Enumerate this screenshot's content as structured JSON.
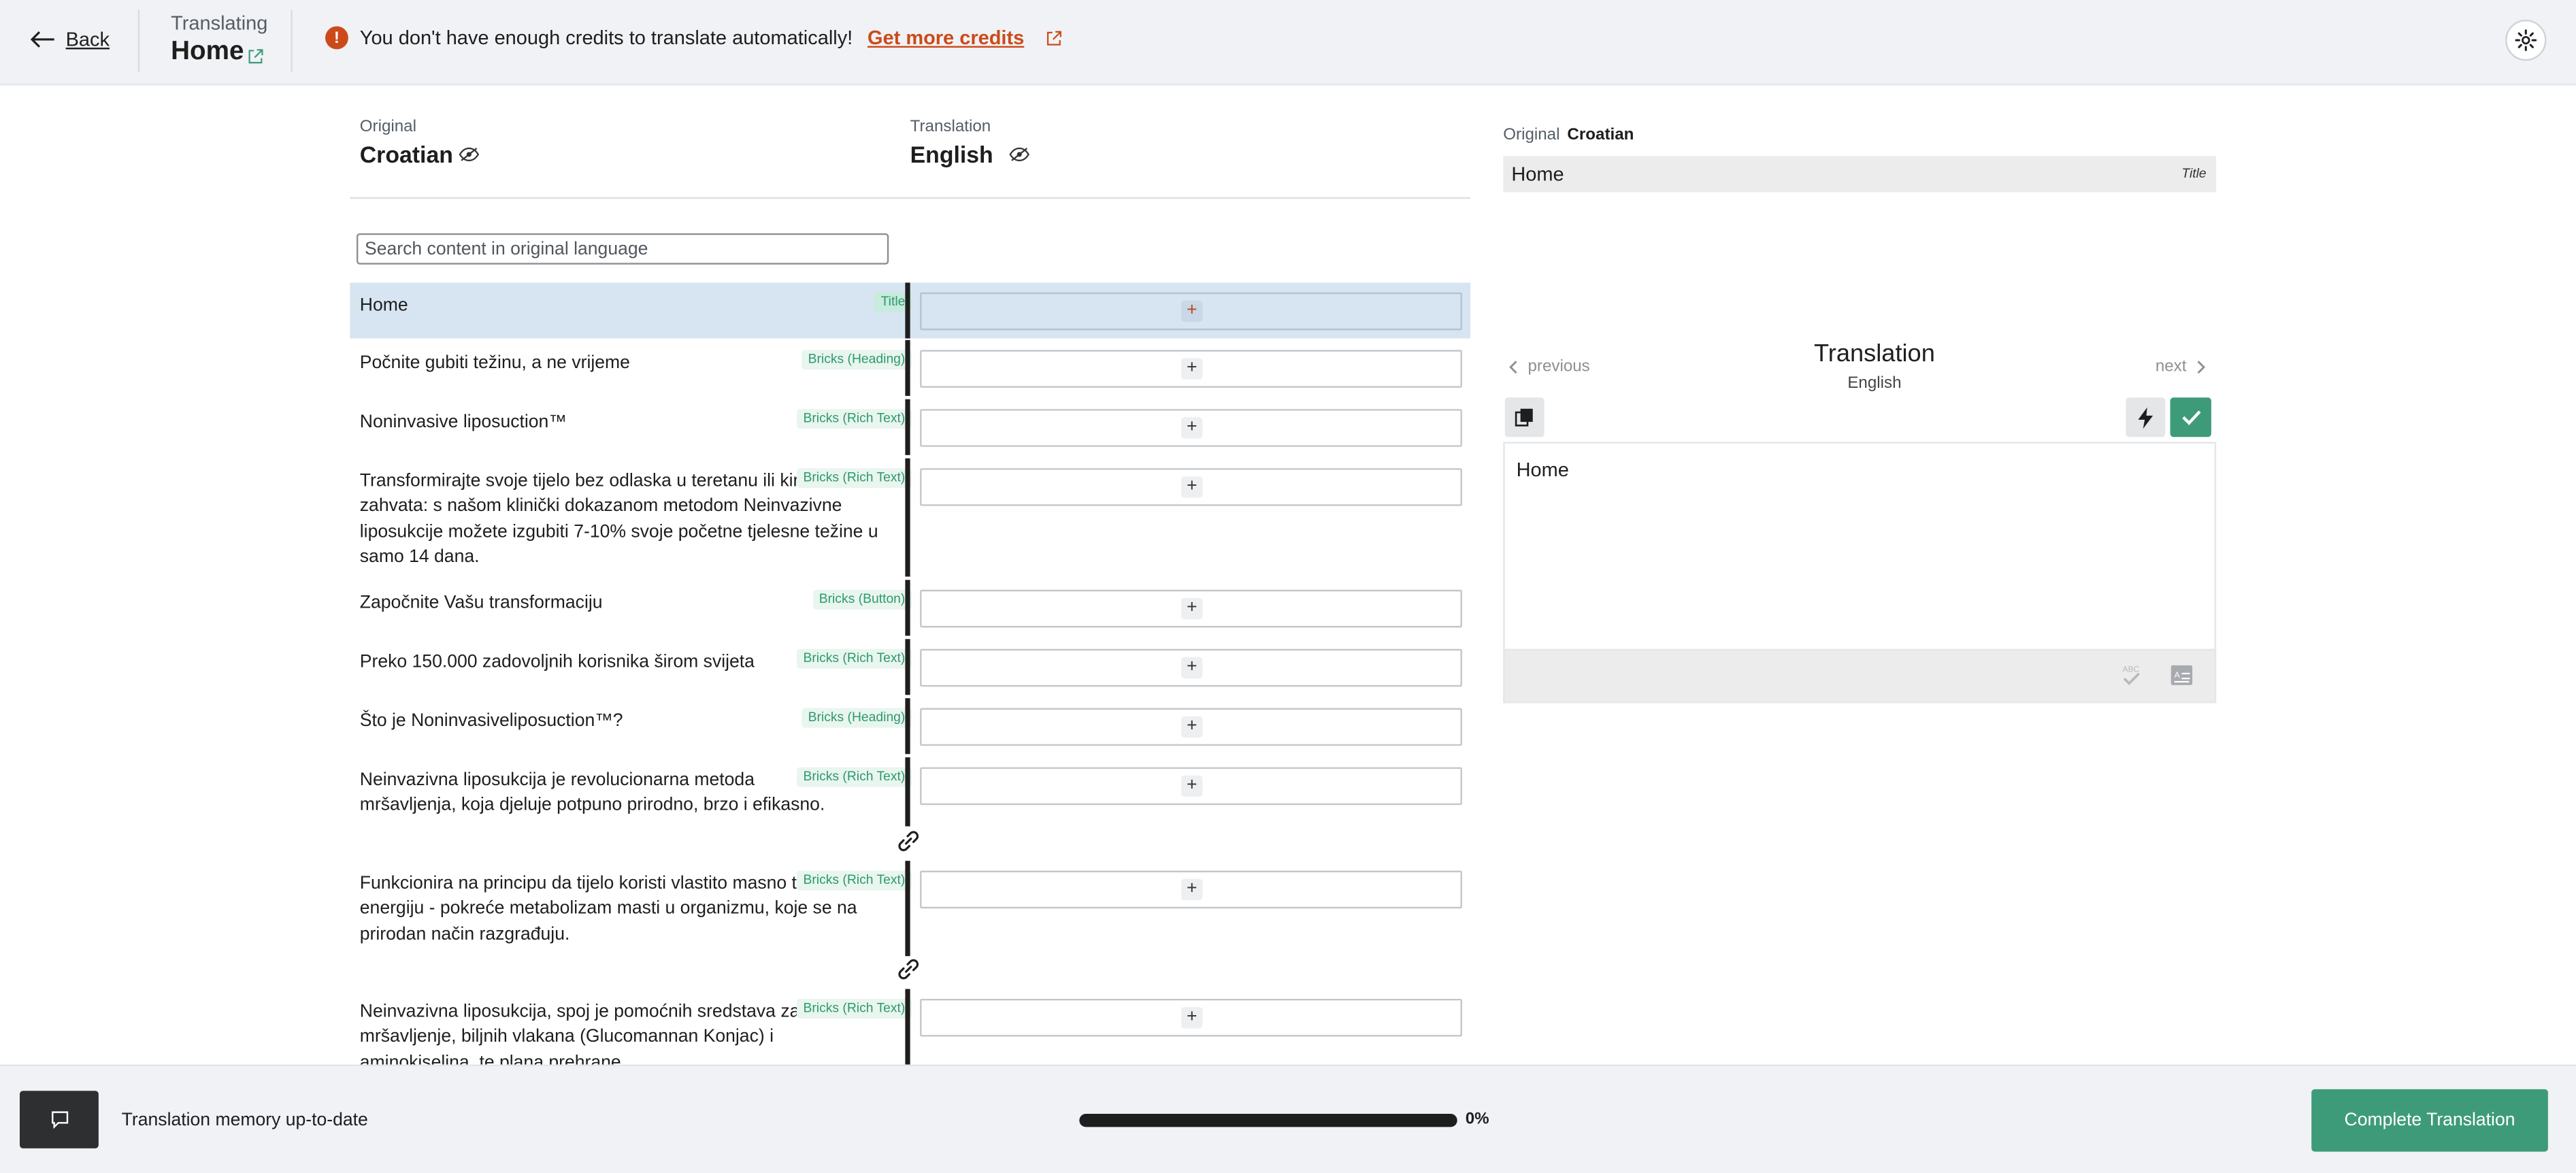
{
  "header": {
    "back_label": "Back",
    "translating_label": "Translating",
    "page_name": "Home",
    "notice_text": "You don't have enough credits to translate automatically!",
    "notice_link": "Get more credits",
    "notice_color": "#cc4a1a"
  },
  "languages": {
    "original_label": "Original",
    "original_name": "Croatian",
    "translation_label": "Translation",
    "translation_name": "English"
  },
  "search": {
    "placeholder": "Search content in original language"
  },
  "rows": [
    {
      "text": "Home",
      "tag": "Title",
      "active": true
    },
    {
      "text": "Počnite gubiti težinu, a ne vrijeme",
      "tag": "Bricks (Heading)"
    },
    {
      "text": "Noninvasive liposuction™",
      "tag": "Bricks (Rich Text)"
    },
    {
      "text": "Transformirajte svoje tijelo bez odlaska u teretanu ili kirurških zahvata: s našom klinički dokazanom metodom Neinvazivne liposukcije možete izgubiti 7-10% svoje početne tjelesne težine u samo 14 dana.",
      "tag": "Bricks (Rich Text)"
    },
    {
      "text": "Započnite Vašu transformaciju",
      "tag": "Bricks (Button)"
    },
    {
      "text": "Preko 150.000 zadovoljnih korisnika širom svijeta",
      "tag": "Bricks (Rich Text)"
    },
    {
      "text": "Što je Noninvasiveliposuction™?",
      "tag": "Bricks (Heading)"
    },
    {
      "text": "Neinvazivna liposukcija je revolucionarna metoda mršavljenja, koja djeluje potpuno prirodno, brzo i efikasno.",
      "tag": "Bricks (Rich Text)"
    },
    {
      "text": "Funkcionira na principu da tijelo koristi vlastito masno tkivo kao energiju - pokreće metabolizam masti u organizmu, koje se na prirodan način razgrađuju.",
      "tag": "Bricks (Rich Text)"
    },
    {
      "text": "Neinvazivna liposukcija, spoj je pomoćnih sredstava za mršavljenje, biljnih vlakana (Glucomannan Konjac) i aminokiselina, te plana prehrane.",
      "tag": "Bricks (Rich Text)"
    }
  ],
  "panel": {
    "original_label": "Original",
    "original_lang": "Croatian",
    "original_text": "Home",
    "original_type": "Title",
    "previous_label": "previous",
    "next_label": "next",
    "title": "Translation",
    "subtitle": "English",
    "editor_text": "Home"
  },
  "footer": {
    "memory_text": "Translation memory up-to-date",
    "progress_percent": 0,
    "progress_label": "0%",
    "complete_label": "Complete Translation"
  },
  "colors": {
    "accent": "#3e9b7a",
    "active_row": "#d6e5f1",
    "tag_text": "#2c9a6d",
    "warning": "#cc4a1a"
  },
  "icons": [
    "arrow-left-icon",
    "external-link-icon",
    "alert-icon",
    "gear-icon",
    "eye-slash-icon",
    "plus-icon",
    "link-icon",
    "chevron-left-icon",
    "chevron-right-icon",
    "copy-icon",
    "lightning-icon",
    "check-icon",
    "spellcheck-icon",
    "glossary-icon",
    "comment-icon"
  ]
}
